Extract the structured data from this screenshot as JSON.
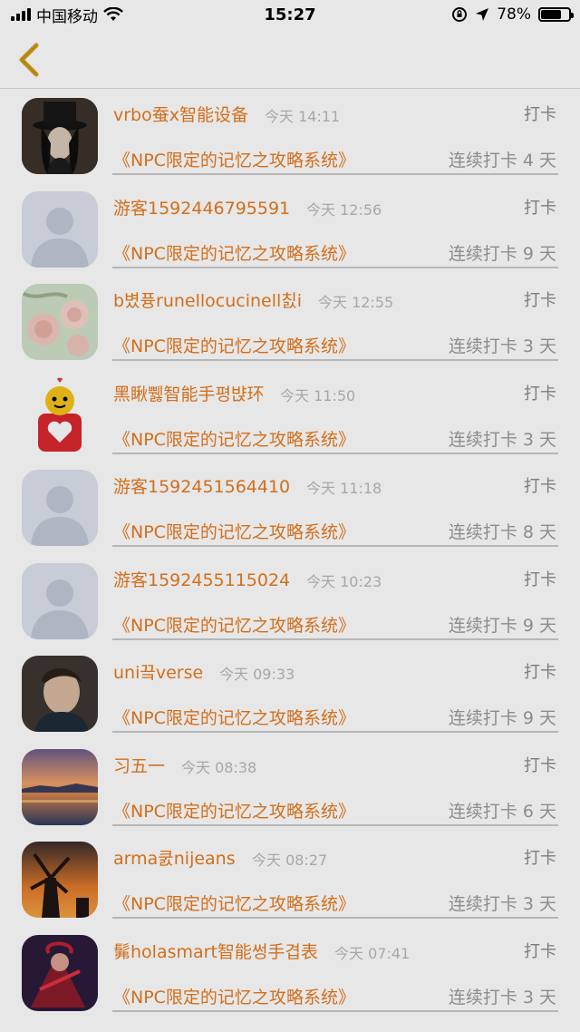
{
  "status_bar": {
    "carrier": "中国移动",
    "time": "15:27",
    "battery": "78%",
    "battery_level": 0.78,
    "icons": [
      "signal-icon",
      "wifi-icon",
      "orientation-lock-icon",
      "location-icon",
      "battery-icon"
    ]
  },
  "nav": {
    "back_icon": "chevron-left-icon",
    "accent_color": "#d4a017"
  },
  "colors": {
    "name": "#e87a1e",
    "time": "#b8b8b8",
    "action": "#8a8a8a",
    "streak": "#9a9a9a",
    "divider": "#c9c9c9"
  },
  "list": {
    "items": [
      {
        "name": "vrbo蚕x智能设备",
        "time": "今天 14:11",
        "action": "打卡",
        "game": "《NPC限定的记忆之攻略系统》",
        "streak": "连续打卡 4 天",
        "avatar": "top-hat-portrait"
      },
      {
        "name": "游客1592446795591",
        "time": "今天 12:56",
        "action": "打卡",
        "game": "《NPC限定的记忆之攻略系统》",
        "streak": "连续打卡 9 天",
        "avatar": "default-person"
      },
      {
        "name": "b볐퓽runellocucinell칤i",
        "time": "今天 12:55",
        "action": "打卡",
        "game": "《NPC限定的记忆之攻略系统》",
        "streak": "连续打卡 3 天",
        "avatar": "roses"
      },
      {
        "name": "黑瞅쀓智能手평뱑环",
        "time": "今天 11:50",
        "action": "打卡",
        "game": "《NPC限定的记忆之攻略系统》",
        "streak": "连续打卡 3 天",
        "avatar": "heart-mascot"
      },
      {
        "name": "游客1592451564410",
        "time": "今天 11:18",
        "action": "打卡",
        "game": "《NPC限定的记忆之攻略系统》",
        "streak": "连续打卡 8 天",
        "avatar": "default-person"
      },
      {
        "name": "游客1592455115024",
        "time": "今天 10:23",
        "action": "打卡",
        "game": "《NPC限定的记忆之攻略系统》",
        "streak": "连续打卡 9 天",
        "avatar": "default-person"
      },
      {
        "name": "uni끜verse",
        "time": "今天 09:33",
        "action": "打卡",
        "game": "《NPC限定的记忆之攻略系统》",
        "streak": "连续打卡 9 天",
        "avatar": "man-portrait"
      },
      {
        "name": "习五一",
        "time": "今天 08:38",
        "action": "打卡",
        "game": "《NPC限定的记忆之攻略系统》",
        "streak": "连续打卡 6 天",
        "avatar": "sunset-sea"
      },
      {
        "name": "arma쿬nijeans",
        "time": "今天 08:27",
        "action": "打卡",
        "game": "《NPC限定的记忆之攻略系统》",
        "streak": "连续打卡 3 天",
        "avatar": "windmill-sunset"
      },
      {
        "name": "髴holasmart智能썽手겹表",
        "time": "今天 07:41",
        "action": "打卡",
        "game": "《NPC限定的记忆之攻略系统》",
        "streak": "连续打卡 3 天",
        "avatar": "warrior-art"
      }
    ]
  }
}
